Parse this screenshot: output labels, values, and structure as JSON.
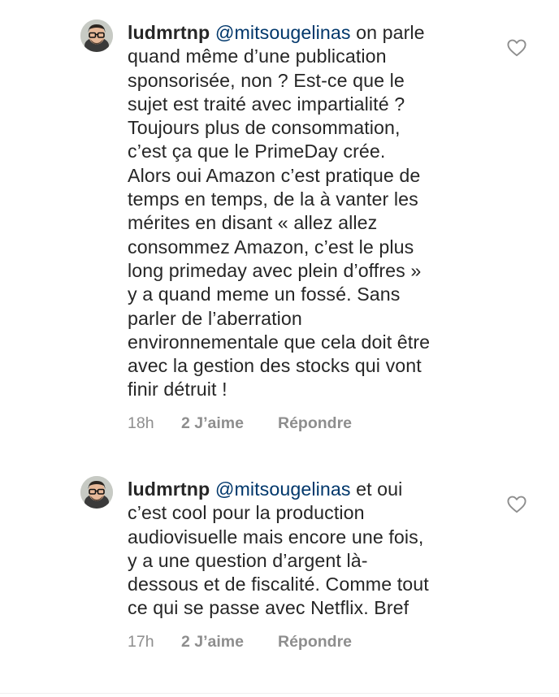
{
  "comments": [
    {
      "username": "ludmrtnp",
      "mention": "@mitsougelinas",
      "first_line_rest": " on parle",
      "lines": [
        "quand même d’une publication",
        "sponsorisée, non ? Est-ce que le",
        "sujet est traité avec impartialité ?",
        "Toujours plus de consommation,",
        "c’est ça que le PrimeDay crée.",
        "Alors oui Amazon c’est pratique de",
        "temps en temps, de la à vanter les",
        "mérites en disant « allez allez",
        "consommez Amazon, c’est le plus",
        "long primeday avec plein d’offres »",
        "y a quand meme un fossé.  Sans",
        "parler de l’aberration",
        "environnementale que cela doit être",
        "avec la gestion des stocks qui vont",
        "finir détruit !"
      ],
      "time": "18h",
      "likes": "2 J’aime",
      "reply": "Répondre",
      "like_icon": "heart-outline-icon"
    },
    {
      "username": "ludmrtnp",
      "mention": "@mitsougelinas",
      "first_line_rest": " et oui",
      "lines": [
        "c’est cool pour la production",
        "audiovisuelle mais encore une fois,",
        "y a une question d’argent là-",
        "dessous et de fiscalité. Comme tout",
        "ce qui se passe avec Netflix.  Bref"
      ],
      "time": "17h",
      "likes": "2 J’aime",
      "reply": "Répondre",
      "like_icon": "heart-outline-icon"
    }
  ],
  "colors": {
    "text": "#262626",
    "mention": "#00376b",
    "secondary": "#8e8e8e"
  }
}
